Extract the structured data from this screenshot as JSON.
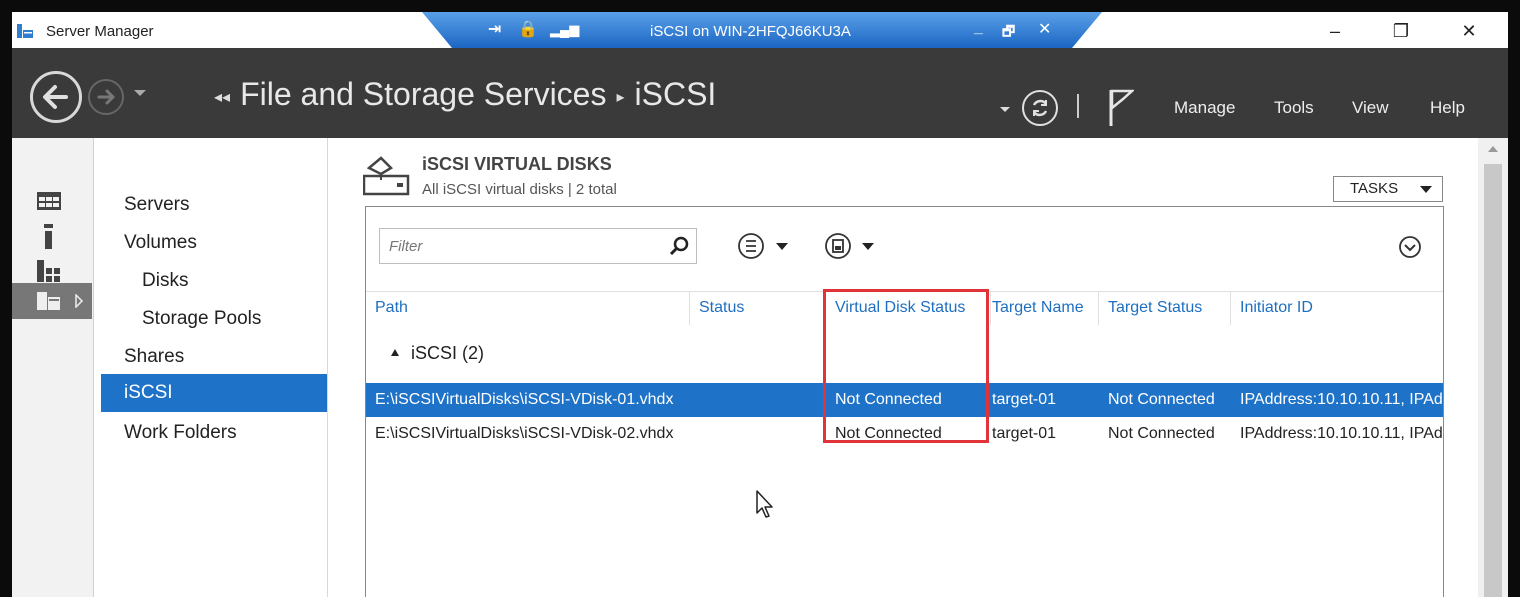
{
  "window": {
    "title": "Server Manager",
    "minimize": "–",
    "restore": "❐",
    "close": "✕"
  },
  "remote_bar": {
    "title": "iSCSI on WIN-2HFQJ66KU3A",
    "minimize": "_",
    "restore": "🗗",
    "close": "✕"
  },
  "header": {
    "breadcrumb_root": "File and Storage Services",
    "breadcrumb_current": "iSCSI",
    "menu": [
      "Manage",
      "Tools",
      "View",
      "Help"
    ]
  },
  "nav": {
    "items": [
      {
        "label": "Servers",
        "sub": false,
        "selected": false
      },
      {
        "label": "Volumes",
        "sub": false,
        "selected": false
      },
      {
        "label": "Disks",
        "sub": true,
        "selected": false
      },
      {
        "label": "Storage Pools",
        "sub": true,
        "selected": false
      },
      {
        "label": "Shares",
        "sub": false,
        "selected": false
      },
      {
        "label": "iSCSI",
        "sub": false,
        "selected": true
      },
      {
        "label": "Work Folders",
        "sub": false,
        "selected": false
      }
    ]
  },
  "section": {
    "title": "iSCSI VIRTUAL DISKS",
    "subtitle": "All iSCSI virtual disks | 2 total",
    "tasks_label": "TASKS",
    "filter_placeholder": "Filter"
  },
  "table": {
    "columns": [
      "Path",
      "Status",
      "Virtual Disk Status",
      "Target Name",
      "Target Status",
      "Initiator ID"
    ],
    "group_label": "iSCSI (2)",
    "rows": [
      {
        "path": "E:\\iSCSIVirtualDisks\\iSCSI-VDisk-01.vhdx",
        "status": "",
        "vdisk_status": "Not Connected",
        "target_name": "target-01",
        "target_status": "Not Connected",
        "initiator_id": "IPAddress:10.10.10.11, IPAd",
        "selected": true
      },
      {
        "path": "E:\\iSCSIVirtualDisks\\iSCSI-VDisk-02.vhdx",
        "status": "",
        "vdisk_status": "Not Connected",
        "target_name": "target-01",
        "target_status": "Not Connected",
        "initiator_id": "IPAddress:10.10.10.11, IPAd",
        "selected": false
      }
    ]
  },
  "colors": {
    "accent": "#1e72c8",
    "header_bg": "#3a3a3a",
    "highlight": "#e0343a",
    "column_header": "#1f6fc1"
  }
}
